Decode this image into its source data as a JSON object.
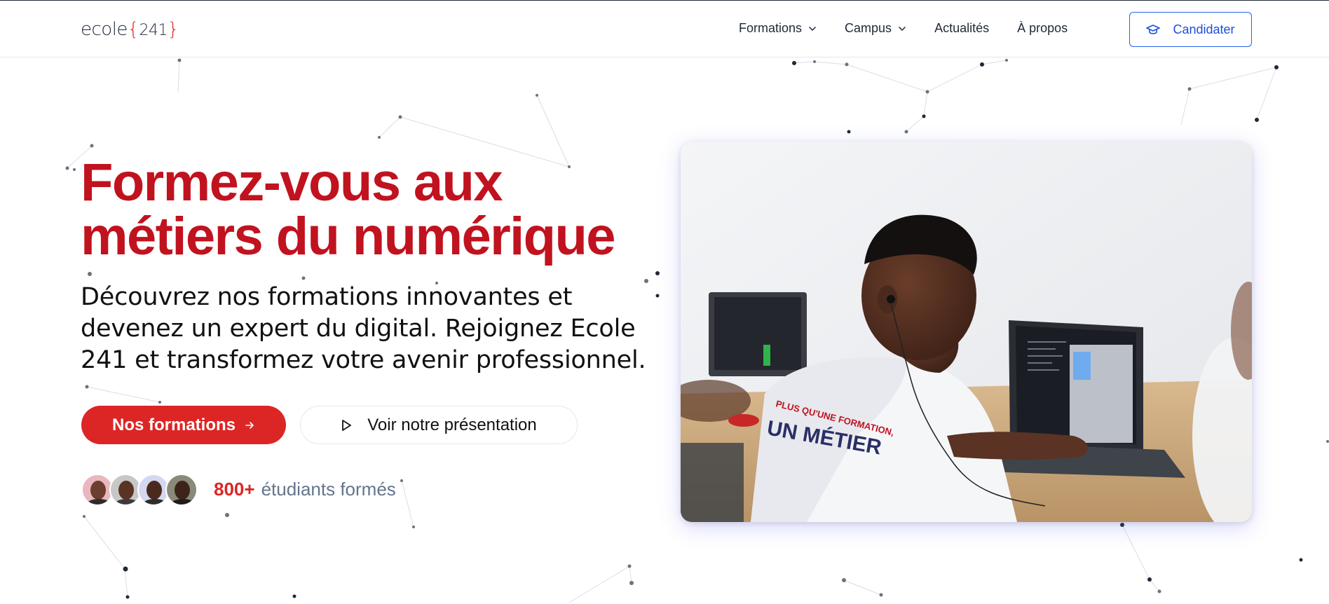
{
  "header": {
    "logo": {
      "word": "ecole",
      "brace_open": "{",
      "number": "241",
      "brace_close": "}"
    },
    "nav": [
      {
        "label": "Formations",
        "has_dropdown": true
      },
      {
        "label": "Campus",
        "has_dropdown": true
      },
      {
        "label": "Actualités",
        "has_dropdown": false
      },
      {
        "label": "À propos",
        "has_dropdown": false
      }
    ],
    "apply_button": {
      "label": "Candidater",
      "icon": "graduation-cap-icon"
    }
  },
  "hero": {
    "title_line1": "Formez-vous aux",
    "title_line2": "métiers du numérique",
    "subtitle_line1": "Découvrez nos formations innovantes et",
    "subtitle_line2": "devenez un expert du digital. Rejoignez Ecole",
    "subtitle_line3": "241 et transformez votre avenir professionnel.",
    "primary_button": {
      "label": "Nos formations",
      "icon": "arrow-right-icon"
    },
    "secondary_button": {
      "label": "Voir notre présentation",
      "icon": "play-icon"
    },
    "stats": {
      "number": "800+",
      "label": "étudiants formés"
    },
    "avatars_count": 4,
    "shirt_text_line1": "PLUS QU'UNE FORMATION,",
    "shirt_text_line2": "UN MÉTIER"
  },
  "colors": {
    "brand_red": "#dc2626",
    "title_red": "#c1121f",
    "accent_blue": "#2563eb",
    "muted_text": "#64748b"
  }
}
